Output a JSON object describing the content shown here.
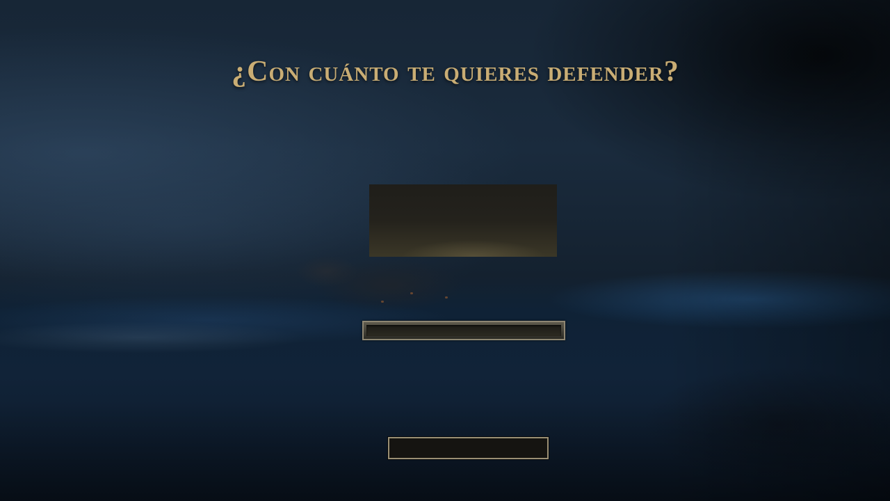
{
  "screen": {
    "title": "¿Con cuánto te quieres defender?"
  },
  "colors": {
    "title_gold": "#c9ad74",
    "panel_dark": "#1f1e1a",
    "frame": "#8e8672"
  },
  "amount_display": {
    "value": ""
  },
  "amount_slider": {
    "value": ""
  },
  "confirm_button": {
    "label": ""
  }
}
